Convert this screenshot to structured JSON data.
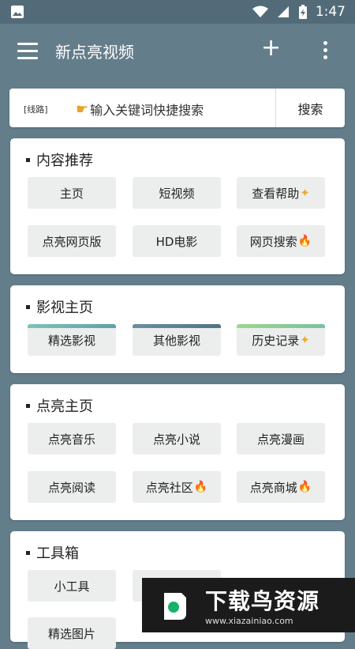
{
  "status": {
    "time": "1:47"
  },
  "appbar": {
    "title": "新点亮视频",
    "menu_icon": "menu-icon",
    "add_icon": "plus-icon",
    "more_icon": "more-vert-icon"
  },
  "search": {
    "route_label": "[线路]",
    "placeholder": "输入关键词快捷搜索",
    "button": "搜索"
  },
  "sections": [
    {
      "title": "内容推荐",
      "tiles": [
        "主页",
        "短视频",
        "查看帮助",
        "点亮网页版",
        "HD电影",
        "网页搜索"
      ]
    },
    {
      "title": "影视主页",
      "tiles": [
        "精选影视",
        "其他影视",
        "历史记录"
      ]
    },
    {
      "title": "点亮主页",
      "tiles": [
        "点亮音乐",
        "点亮小说",
        "点亮漫画",
        "点亮阅读",
        "点亮社区",
        "点亮商城"
      ]
    },
    {
      "title": "工具箱",
      "tiles": [
        "小工具",
        "精选图片"
      ]
    }
  ],
  "ad": {
    "big": "下载鸟资源",
    "small": "www.xiazainiao.com"
  },
  "colors": {
    "background": "#647d8b",
    "statusbar": "#536b78",
    "tile": "#eceded",
    "accent_gold": "#e8b02a",
    "fire": "#e8542a"
  }
}
